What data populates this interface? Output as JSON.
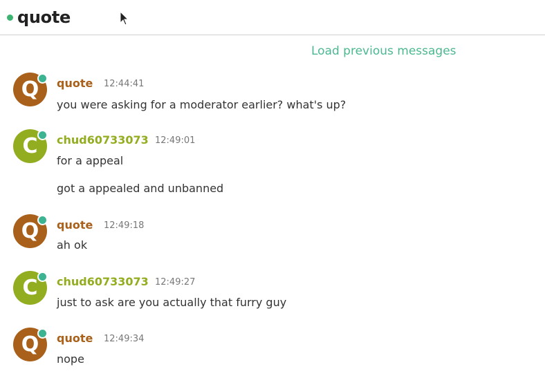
{
  "header": {
    "title": "quote",
    "status_color": "#3cb371"
  },
  "load_previous": "Load previous messages",
  "colors": {
    "accent": "#4cb890",
    "quote_user": "#a8601a",
    "chud_user": "#92ad1f",
    "online": "#3cb391"
  },
  "messages": [
    {
      "avatar": "Q",
      "user": "quote",
      "time": "12:44:41",
      "lines": [
        "you were asking for a moderator earlier? what's up?"
      ]
    },
    {
      "avatar": "C",
      "user": "chud60733073",
      "time": "12:49:01",
      "lines": [
        "for a appeal",
        "got a appealed and unbanned"
      ]
    },
    {
      "avatar": "Q",
      "user": "quote",
      "time": "12:49:18",
      "lines": [
        "ah ok"
      ]
    },
    {
      "avatar": "C",
      "user": "chud60733073",
      "time": "12:49:27",
      "lines": [
        "just to ask are you actually that furry guy"
      ]
    },
    {
      "avatar": "Q",
      "user": "quote",
      "time": "12:49:34",
      "lines": [
        "nope"
      ]
    }
  ]
}
